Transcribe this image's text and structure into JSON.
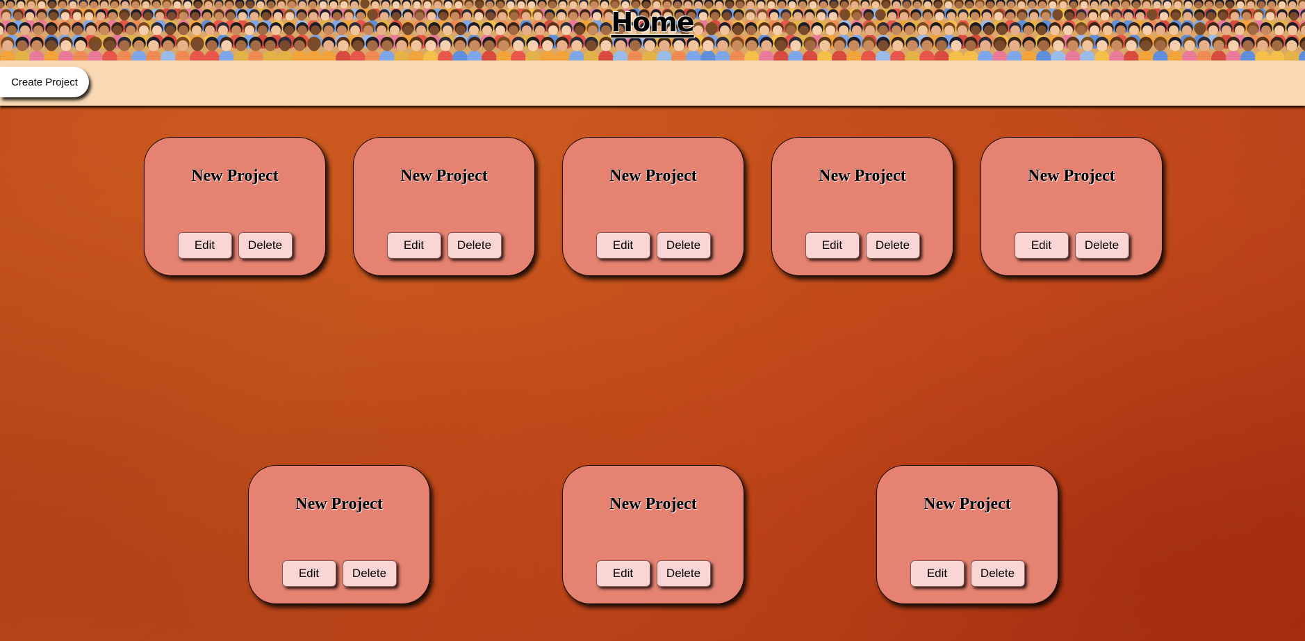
{
  "header": {
    "title": "Home",
    "banner_image": "crowd-of-people-illustration"
  },
  "toolbar": {
    "create_label": "Create Project"
  },
  "projects": [
    {
      "title": "New Project",
      "edit_label": "Edit",
      "delete_label": "Delete"
    },
    {
      "title": "New Project",
      "edit_label": "Edit",
      "delete_label": "Delete"
    },
    {
      "title": "New Project",
      "edit_label": "Edit",
      "delete_label": "Delete"
    },
    {
      "title": "New Project",
      "edit_label": "Edit",
      "delete_label": "Delete"
    },
    {
      "title": "New Project",
      "edit_label": "Edit",
      "delete_label": "Delete"
    },
    {
      "title": "New Project",
      "edit_label": "Edit",
      "delete_label": "Delete"
    },
    {
      "title": "New Project",
      "edit_label": "Edit",
      "delete_label": "Delete"
    },
    {
      "title": "New Project",
      "edit_label": "Edit",
      "delete_label": "Delete"
    }
  ],
  "colors": {
    "background": "#b9441a",
    "toolbar": "#f8d9b4",
    "card": "#e58272",
    "card_button": "#f9d6d3",
    "create_button": "#ffffff"
  }
}
